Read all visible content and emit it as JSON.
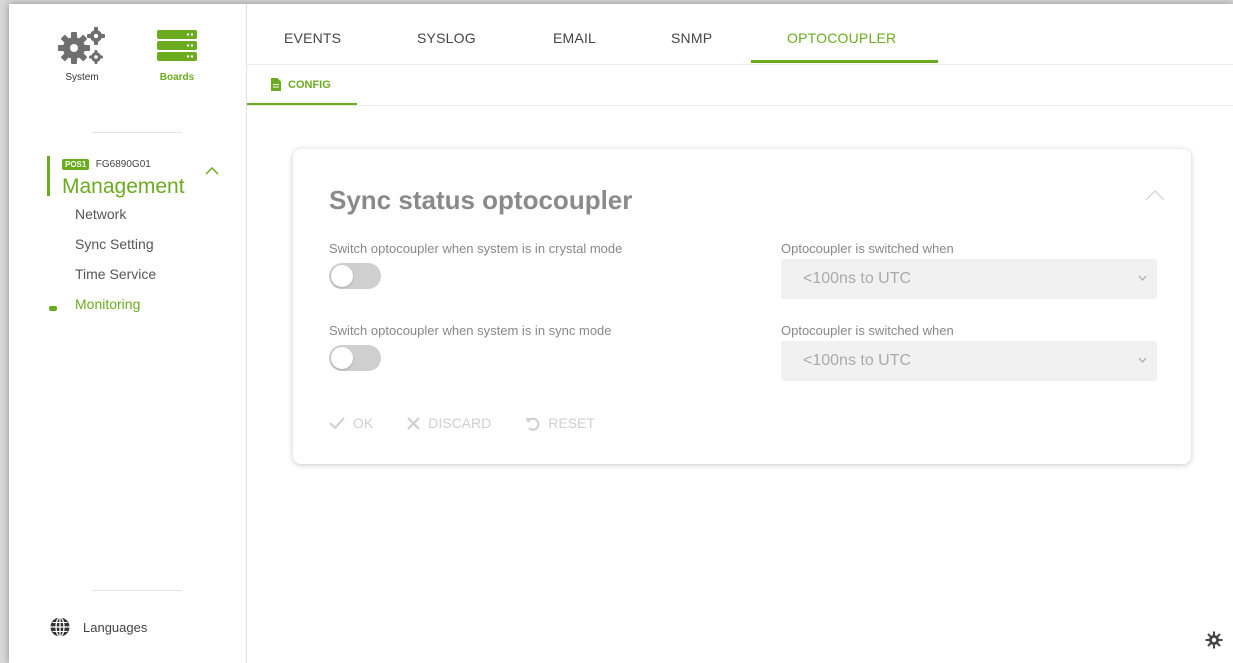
{
  "sidebar": {
    "top_icons": [
      {
        "label": "System",
        "icon": "gears-icon"
      },
      {
        "label": "Boards",
        "icon": "boards-icon"
      }
    ],
    "module": {
      "pos": "POS1",
      "serial": "FG6890G01",
      "title": "Management"
    },
    "nav": [
      {
        "label": "Network"
      },
      {
        "label": "Sync Setting"
      },
      {
        "label": "Time Service"
      },
      {
        "label": "Monitoring"
      }
    ],
    "languages_label": "Languages"
  },
  "tabs": [
    "EVENTS",
    "SYSLOG",
    "EMAIL",
    "SNMP",
    "OPTOCOUPLER"
  ],
  "subtab": {
    "label": "CONFIG"
  },
  "card": {
    "title": "Sync status optocoupler",
    "rows": [
      {
        "toggle_label": "Switch optocoupler when system is in crystal mode",
        "select_label": "Optocoupler is switched when",
        "select_value": "<100ns to UTC"
      },
      {
        "toggle_label": "Switch optocoupler when system is in sync mode",
        "select_label": "Optocoupler is switched when",
        "select_value": "<100ns to UTC"
      }
    ],
    "actions": {
      "ok": "OK",
      "discard": "DISCARD",
      "reset": "RESET"
    }
  },
  "colors": {
    "accent": "#6aac1d"
  }
}
